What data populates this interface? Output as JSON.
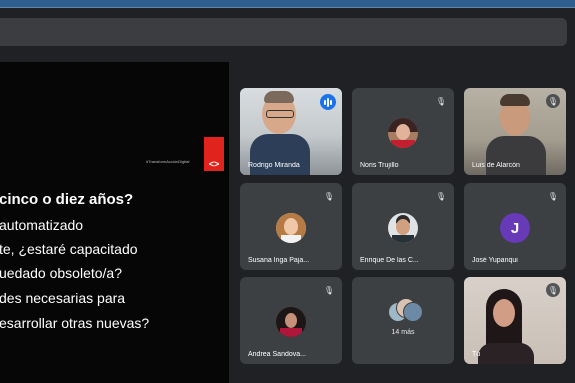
{
  "presentation": {
    "hashtag": "#TransformAcciónDigital",
    "logo_symbol": "<>",
    "lines": [
      "cinco o diez años?",
      "automatizado",
      "te, ¿estaré capacitado",
      "uedado obsoleto/a?",
      "des necesarias para",
      "esarrollar otras nuevas?"
    ]
  },
  "participants": [
    {
      "name": "Rodrigo Miranda",
      "mic": "speaking",
      "view": "video"
    },
    {
      "name": "Noris Trujillo",
      "mic": "muted",
      "view": "avatar"
    },
    {
      "name": "Luis de Alarcón",
      "mic": "muted",
      "view": "video"
    },
    {
      "name": "Susana Inga Paja...",
      "mic": "muted",
      "view": "avatar"
    },
    {
      "name": "Enrique De las C...",
      "mic": "muted",
      "view": "avatar"
    },
    {
      "name": "José Yupanqui",
      "mic": "muted",
      "view": "letter",
      "initial": "J",
      "color": "#673ab7"
    },
    {
      "name": "Andrea Sandova...",
      "mic": "muted",
      "view": "avatar"
    },
    {
      "name": "14 más",
      "view": "group"
    },
    {
      "name": "Tú",
      "mic": "muted",
      "view": "video"
    }
  ],
  "icons": {
    "muted": "mic-off-icon",
    "speaking": "audio-level-icon"
  },
  "colors": {
    "accent": "#1a73e8",
    "tile": "#3c4043",
    "background": "#202124",
    "logo": "#e0231c"
  }
}
